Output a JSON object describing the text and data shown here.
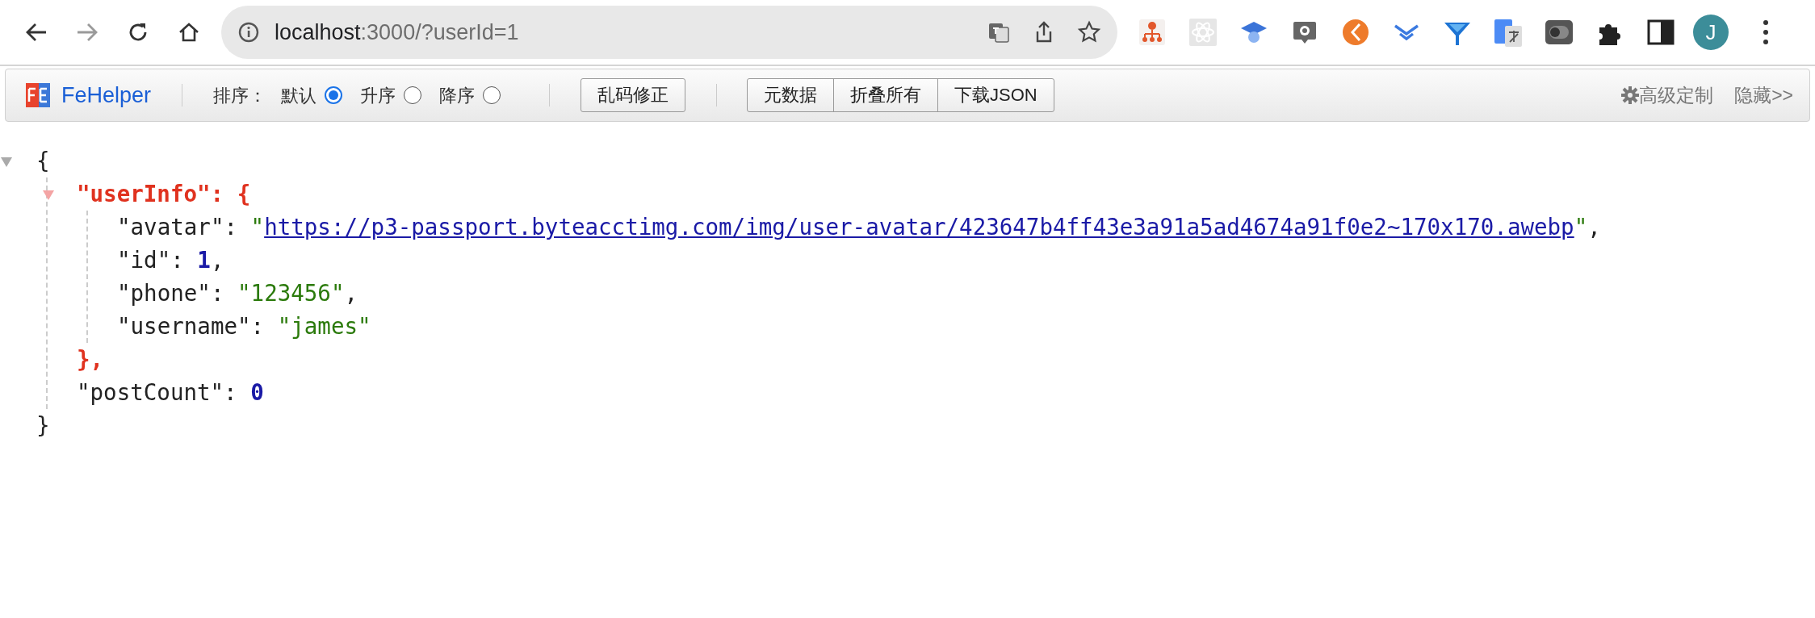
{
  "browser": {
    "forward_disabled": true,
    "address": {
      "host": "localhost",
      "rest": ":3000/?userId=1"
    },
    "profile_initial": "J"
  },
  "toolbar": {
    "brand": "FeHelper",
    "sort_label": "排序：",
    "sort_options": [
      {
        "label": "默认",
        "selected": true
      },
      {
        "label": "升序",
        "selected": false
      },
      {
        "label": "降序",
        "selected": false
      }
    ],
    "fix_button": "乱码修正",
    "button_group": [
      "元数据",
      "折叠所有",
      "下载JSON"
    ],
    "settings_link": "高级定制",
    "hide_link": "隐藏>>"
  },
  "json_view": {
    "expanded": true,
    "open": [
      {
        "kind": "plain",
        "text": "{"
      }
    ],
    "members": [
      {
        "kind": "object",
        "expanded": true,
        "open": [
          {
            "kind": "accent",
            "text": "\"userInfo\": {"
          }
        ],
        "members": [
          {
            "kind": "line",
            "tokens": [
              {
                "kind": "plain",
                "text": "\"avatar\": "
              },
              {
                "kind": "string",
                "text": "\""
              },
              {
                "kind": "link",
                "text": "https://p3-passport.byteacctimg.com/img/user-avatar/423647b4ff43e3a91a5ad4674a91f0e2~170x170.awebp"
              },
              {
                "kind": "string",
                "text": "\""
              },
              {
                "kind": "plain",
                "text": ","
              }
            ]
          },
          {
            "kind": "line",
            "tokens": [
              {
                "kind": "plain",
                "text": "\"id\": "
              },
              {
                "kind": "number",
                "text": "1"
              },
              {
                "kind": "plain",
                "text": ","
              }
            ]
          },
          {
            "kind": "line",
            "tokens": [
              {
                "kind": "plain",
                "text": "\"phone\": "
              },
              {
                "kind": "string",
                "text": "\"123456\""
              },
              {
                "kind": "plain",
                "text": ","
              }
            ]
          },
          {
            "kind": "line",
            "tokens": [
              {
                "kind": "plain",
                "text": "\"username\": "
              },
              {
                "kind": "string",
                "text": "\"james\""
              }
            ]
          }
        ],
        "close": [
          {
            "kind": "accent",
            "text": "},"
          }
        ]
      },
      {
        "kind": "line",
        "tokens": [
          {
            "kind": "plain",
            "text": "\"postCount\": "
          },
          {
            "kind": "number",
            "text": "0"
          }
        ]
      }
    ],
    "close": [
      {
        "kind": "plain",
        "text": "}"
      }
    ]
  }
}
